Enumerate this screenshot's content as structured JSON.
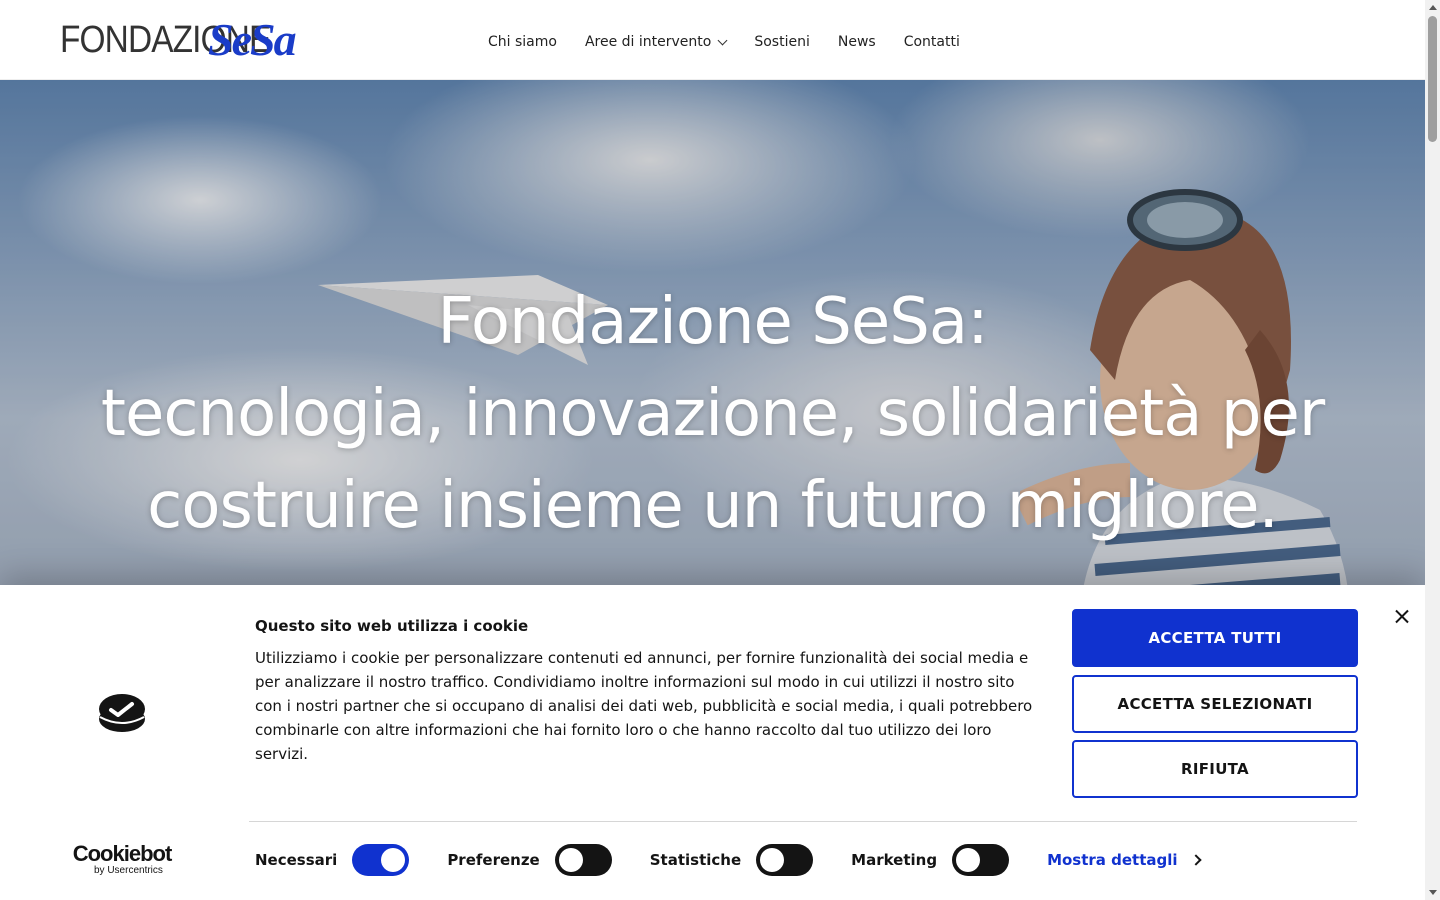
{
  "header": {
    "logo_text": "FONDAZIONE",
    "logo_mark": "SeSa",
    "nav": [
      {
        "label": "Chi siamo"
      },
      {
        "label": "Aree di intervento",
        "icon": "chevron-down-icon"
      },
      {
        "label": "Sostieni"
      },
      {
        "label": "News"
      },
      {
        "label": "Contatti"
      }
    ]
  },
  "hero": {
    "line1": "Fondazione SeSa:",
    "line2": "tecnologia, innovazione, solidarietà per",
    "line3": "costruire insieme un futuro migliore."
  },
  "cookie_banner": {
    "title": "Questo sito web utilizza i cookie",
    "text": "Utilizziamo i cookie per personalizzare contenuti ed annunci, per fornire funzionalità dei social media e per analizzare il nostro traffico. Condividiamo inoltre informazioni sul modo in cui utilizzi il nostro sito con i nostri partner che si occupano di analisi dei dati web, pubblicità e social media, i quali potrebbero combinarle con altre informazioni che hai fornito loro o che hanno raccolto dal tuo utilizzo dei loro servizi.",
    "brand_main": "Cookiebot",
    "brand_sub": "by Usercentrics",
    "toggles": [
      {
        "label": "Necessari",
        "on": true
      },
      {
        "label": "Preferenze",
        "on": false
      },
      {
        "label": "Statistiche",
        "on": false
      },
      {
        "label": "Marketing",
        "on": false
      }
    ],
    "show_details": "Mostra dettagli",
    "btn_accept_all": "ACCETTA TUTTI",
    "btn_accept_selected": "ACCETTA SELEZIONATI",
    "btn_refuse": "RIFIUTA"
  },
  "colors": {
    "brand_blue": "#1032cf",
    "logo_blue": "#1a3cc8"
  }
}
